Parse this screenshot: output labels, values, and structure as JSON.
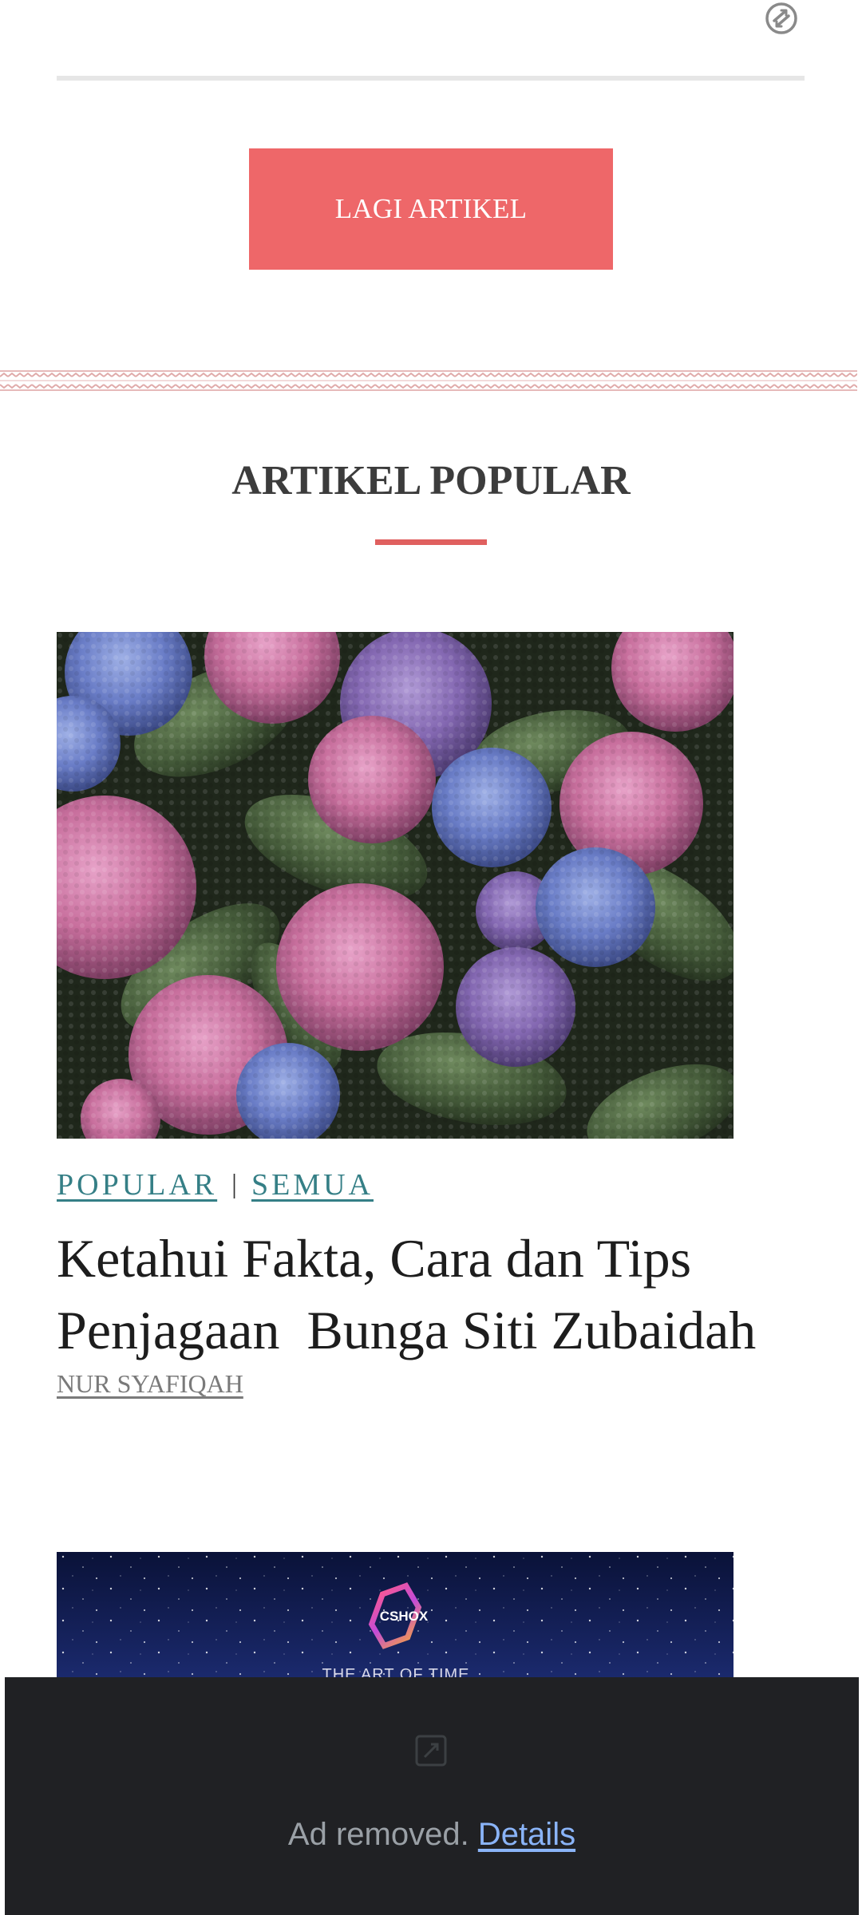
{
  "top": {
    "icon": "arrows-circle-icon"
  },
  "more_button": {
    "label": "LAGI ARTIKEL",
    "color": "#ee6769"
  },
  "popular_section": {
    "title": "ARTIKEL POPULAR",
    "accent": "#e0605f"
  },
  "article": {
    "image": "hydrangea-flowers-photo",
    "categories": [
      "POPULAR",
      "SEMUA"
    ],
    "category_separator": "|",
    "category_color": "#357f86",
    "title": "Ketahui Fakta, Cara dan Tips Penjagaan  Bunga Siti Zubaidah",
    "author": "NUR SYAFIQAH"
  },
  "next_article": {
    "image": "cshox-watch-ad-image",
    "logo_text": "CSHOX",
    "tagline": "THE ART OF TIME"
  },
  "ad_overlay": {
    "icon": "ad-blocked-icon",
    "text": "Ad removed.",
    "link": "Details",
    "background": "#202124",
    "link_color": "#8ab4f8"
  }
}
